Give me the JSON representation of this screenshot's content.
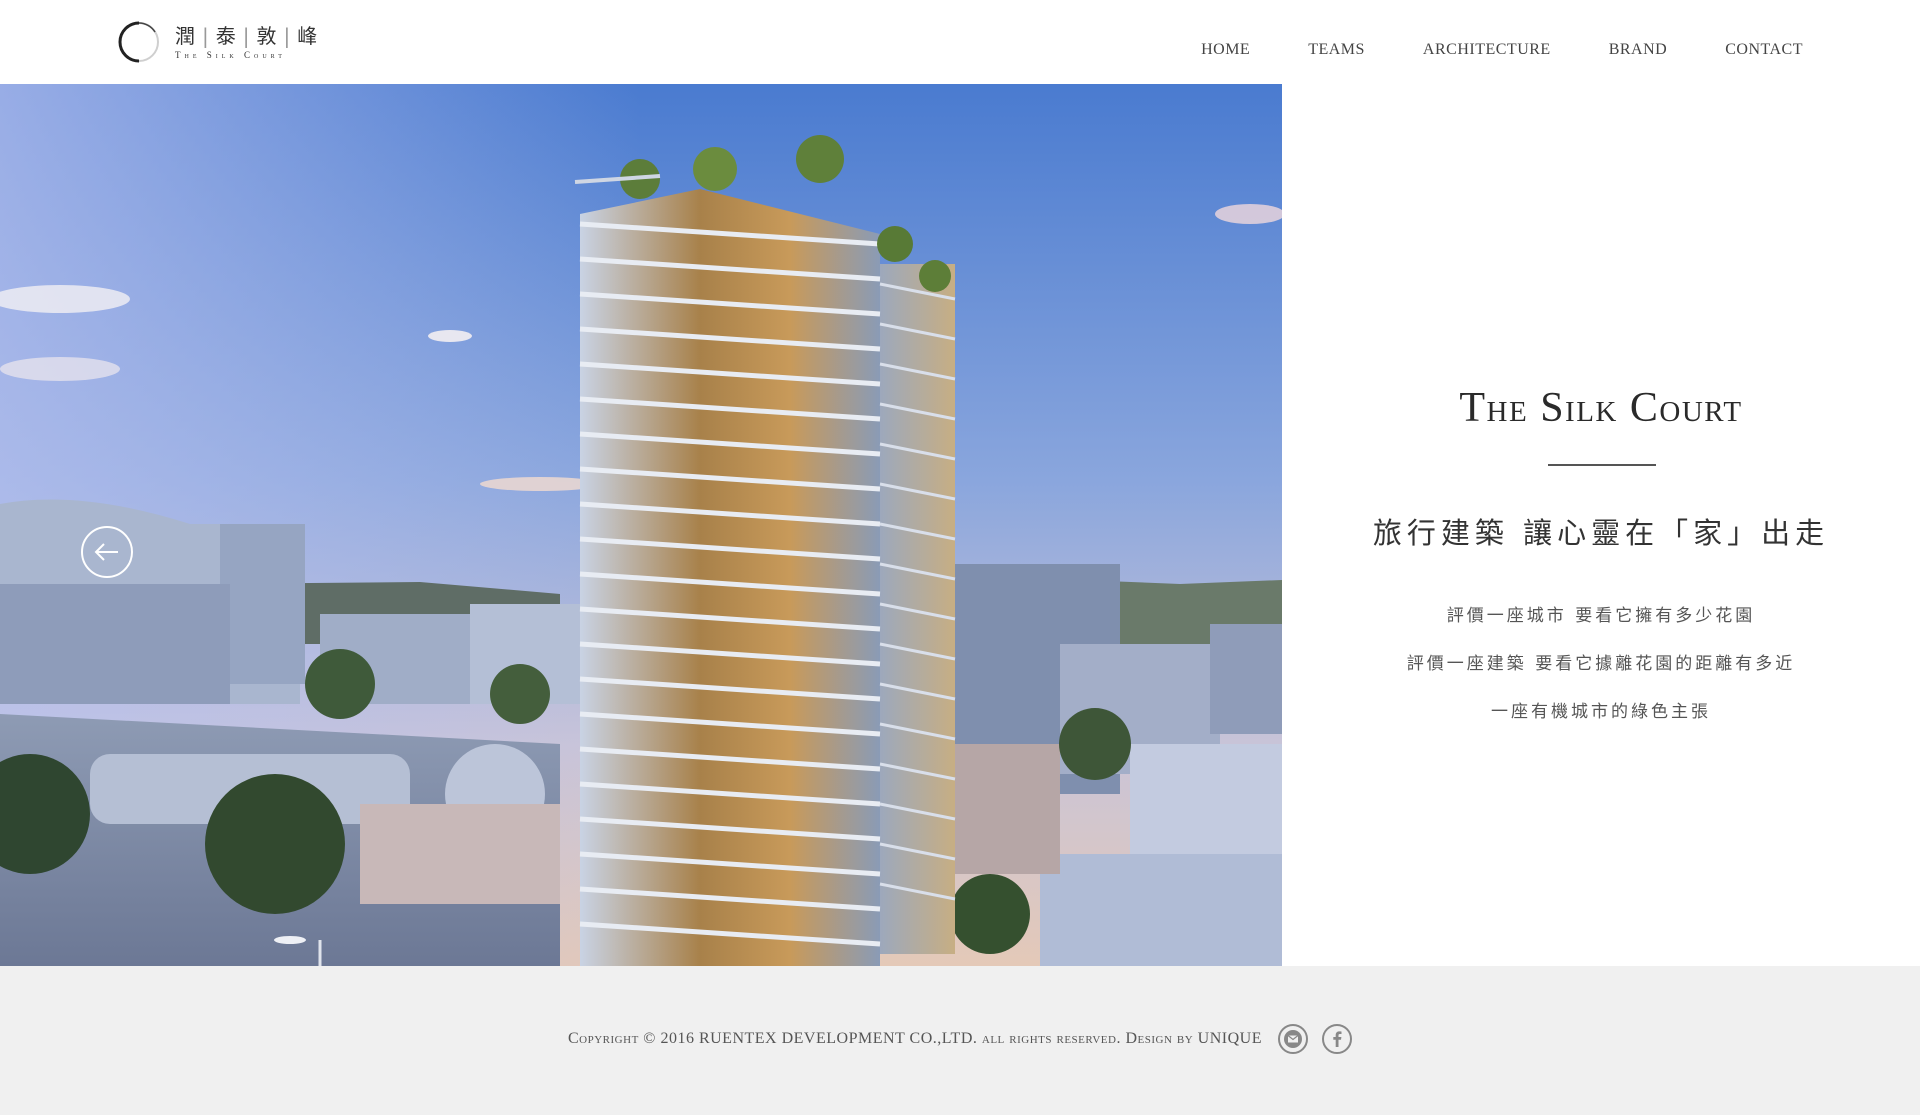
{
  "header": {
    "logo_zh": [
      "潤",
      "泰",
      "敦",
      "峰"
    ],
    "logo_en": "The Silk Court",
    "nav": [
      {
        "label": "HOME"
      },
      {
        "label": "TEAMS"
      },
      {
        "label": "ARCHITECTURE"
      },
      {
        "label": "BRAND"
      },
      {
        "label": "CONTACT"
      }
    ]
  },
  "hero": {
    "image_icon": "building-rendering-image",
    "prev_icon": "arrow-left-icon"
  },
  "panel": {
    "title": "The Silk Court",
    "tagline": "旅行建築 讓心靈在「家」出走",
    "lines": [
      "評價一座城市 要看它擁有多少花園",
      "評價一座建築 要看它據離花園的距離有多近",
      "一座有機城市的綠色主張"
    ]
  },
  "footer": {
    "copyright": "Copyright © 2016 RUENTEX DEVELOPMENT CO.,LTD. all rights reserved. Design by UNIQUE",
    "icons": [
      "mail-icon",
      "facebook-icon"
    ]
  },
  "colors": {
    "text_dark": "#2a2a2a",
    "text_mid": "#555555",
    "footer_bg": "#f0f0f0",
    "sky_top": "#4f7fd4",
    "sky_bottom": "#d8c8c8"
  }
}
